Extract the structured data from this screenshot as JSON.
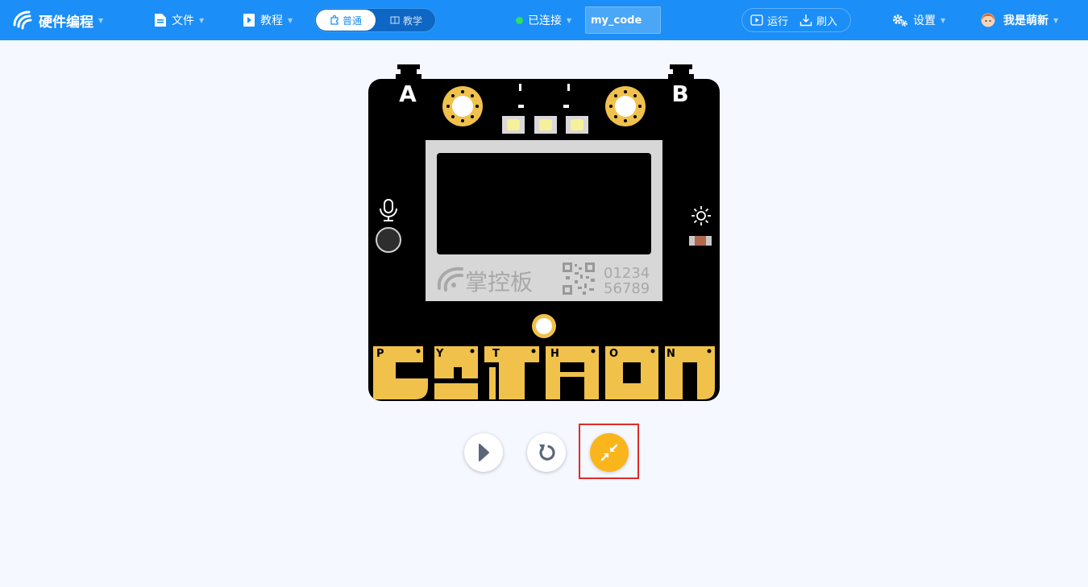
{
  "app": {
    "name": "硬件编程"
  },
  "menu": {
    "file": "文件",
    "tutorial": "教程"
  },
  "mode": {
    "normal": "普通",
    "teach": "教学"
  },
  "connection": {
    "status": "已连接",
    "dot_color": "#2ee05a"
  },
  "filename": {
    "value": "my_code"
  },
  "actions": {
    "run": "运行",
    "flash": "刷入"
  },
  "settings": {
    "label": "设置"
  },
  "user": {
    "name": "我是萌新"
  },
  "board": {
    "button_a": "A",
    "button_b": "B",
    "logo_text": "掌控板",
    "serial_line1": "01234",
    "serial_line2": "56789",
    "pin_labels": [
      "P",
      "Y",
      "T",
      "H",
      "O",
      "N"
    ]
  },
  "colors": {
    "topbar": "#1b8ef7",
    "gold": "#f0c14b",
    "accent_button": "#fab51c",
    "highlight": "#e12a2a"
  },
  "controls": {
    "play_icon": "play-icon",
    "reset_icon": "reset-icon",
    "collapse_icon": "collapse-icon"
  }
}
